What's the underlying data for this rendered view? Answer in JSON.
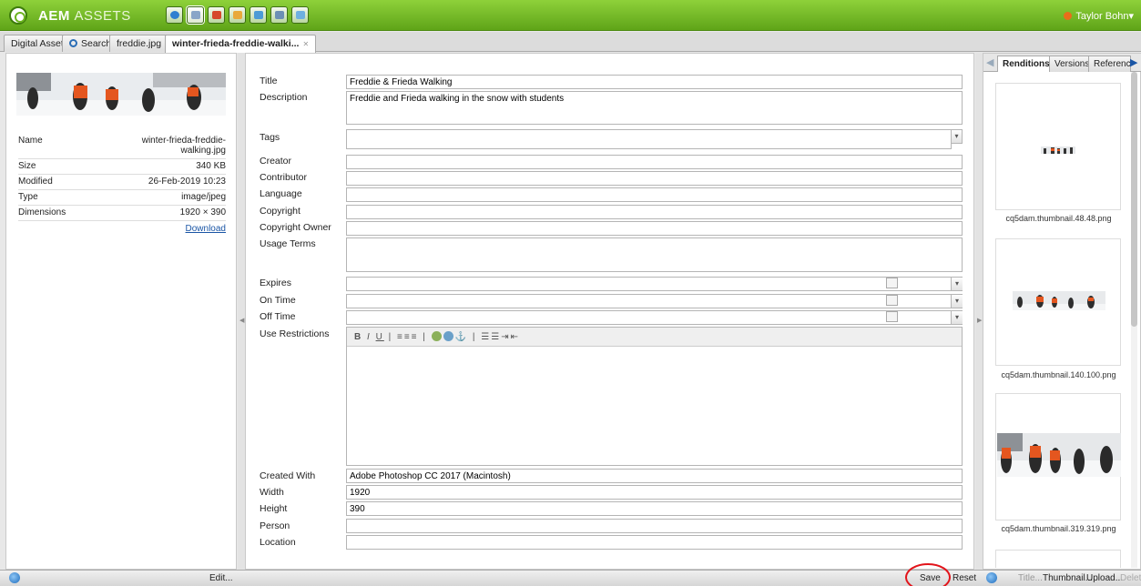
{
  "app": {
    "title_bold": "AEM",
    "title_thin": "ASSETS",
    "user": "Taylor Bohn▾",
    "toolbar_icons": [
      "globe-icon",
      "image-icon",
      "flag-icon",
      "mail-icon",
      "photo-icon",
      "check-icon",
      "tag-icon"
    ]
  },
  "tabs": [
    {
      "label": "Digital Assets"
    },
    {
      "label": "Search"
    },
    {
      "label": "freddie.jpg"
    },
    {
      "label": "winter-frieda-freddie-walki..."
    }
  ],
  "asset_info": {
    "rows": [
      {
        "key": "Name",
        "value": "winter-frieda-freddie-walking.jpg"
      },
      {
        "key": "Size",
        "value": "340 KB"
      },
      {
        "key": "Modified",
        "value": "26-Feb-2019 10:23"
      },
      {
        "key": "Type",
        "value": "image/jpeg"
      },
      {
        "key": "Dimensions",
        "value": "1920 × 390"
      }
    ],
    "download": "Download"
  },
  "form": {
    "title": {
      "label": "Title",
      "value": "Freddie & Frieda Walking"
    },
    "description": {
      "label": "Description",
      "value": "Freddie and Frieda walking in the snow with students"
    },
    "tags": {
      "label": "Tags",
      "value": ""
    },
    "creator": {
      "label": "Creator",
      "value": ""
    },
    "contributor": {
      "label": "Contributor",
      "value": ""
    },
    "language": {
      "label": "Language",
      "value": ""
    },
    "copyright": {
      "label": "Copyright",
      "value": ""
    },
    "copyright_owner": {
      "label": "Copyright Owner",
      "value": ""
    },
    "usage_terms": {
      "label": "Usage Terms",
      "value": ""
    },
    "expires": {
      "label": "Expires",
      "value": ""
    },
    "on_time": {
      "label": "On Time",
      "value": ""
    },
    "off_time": {
      "label": "Off Time",
      "value": ""
    },
    "use_restrictions": {
      "label": "Use Restrictions",
      "toolbar": "B I U | ≡ ≡ ≡ | ⚓ | ☰ ☰ ⇥ ⇤"
    },
    "created_with": {
      "label": "Created With",
      "value": "Adobe Photoshop CC 2017 (Macintosh)"
    },
    "width": {
      "label": "Width",
      "value": "1920"
    },
    "height": {
      "label": "Height",
      "value": "390"
    },
    "person": {
      "label": "Person",
      "value": ""
    },
    "location": {
      "label": "Location",
      "value": ""
    }
  },
  "renditions": {
    "tabs": [
      "Renditions",
      "Versions",
      "References"
    ],
    "items": [
      {
        "name": "cq5dam.thumbnail.48.48.png"
      },
      {
        "name": "cq5dam.thumbnail.140.100.png"
      },
      {
        "name": "cq5dam.thumbnail.319.319.png"
      }
    ]
  },
  "bottom": {
    "edit": "Edit...",
    "save": "Save",
    "reset": "Reset",
    "title": "Title...",
    "thumbnail": "Thumbnail...",
    "upload": "Upload...",
    "delete": "Delete"
  },
  "colors": {
    "brand_green": "#6bb31f",
    "highlight_red": "#e2141b",
    "link_blue": "#1a55a5"
  }
}
